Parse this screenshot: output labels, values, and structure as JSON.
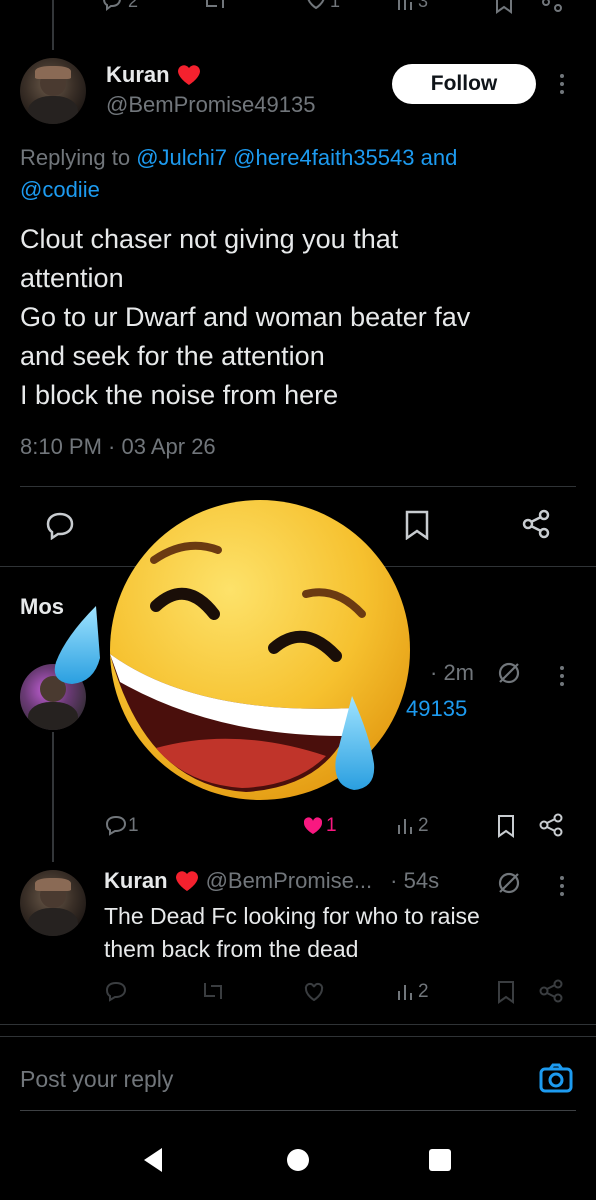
{
  "top_stats": {
    "replies": "2",
    "views": "3",
    "likes": "1"
  },
  "main_post": {
    "author_name": "Kuran",
    "author_handle": "@BemPromise49135",
    "follow_label": "Follow",
    "replying_prefix": "Replying to",
    "replying_mentions_line1": "@Julchi7 @here4faith35543",
    "replying_and": "and",
    "replying_mentions_line2": "@codiie",
    "text_lines": [
      "Clout chaser not giving you that",
      "attention",
      "Go to ur Dwarf and woman beater fav",
      "and seek for the attention",
      "I block the noise from here"
    ],
    "timestamp": "8:10 PM · 03 Apr 26"
  },
  "section_label": "Mos",
  "reply1": {
    "time": "· 2m",
    "handle_fragment": "49135",
    "reply_count": "1",
    "like_count": "1",
    "views": "2"
  },
  "reply2": {
    "author_name": "Kuran",
    "author_handle": "@BemPromise...",
    "time": "· 54s",
    "text_lines": [
      "The Dead Fc looking for who to raise",
      "them back from the dead"
    ],
    "views": "2"
  },
  "reply_box": {
    "placeholder": "Post your reply"
  },
  "colors": {
    "accent": "#1d9bf0",
    "like": "#f91880",
    "verified_heart": "#f4212e",
    "emoji_yellow": "#f6c12f"
  },
  "icons": [
    "reply-icon",
    "retweet-icon",
    "like-icon",
    "views-icon",
    "bookmark-icon",
    "share-icon",
    "more-icon",
    "heart-icon",
    "camera-icon",
    "laughing-crying-emoji",
    "back-nav-icon",
    "home-nav-icon",
    "recents-nav-icon"
  ]
}
